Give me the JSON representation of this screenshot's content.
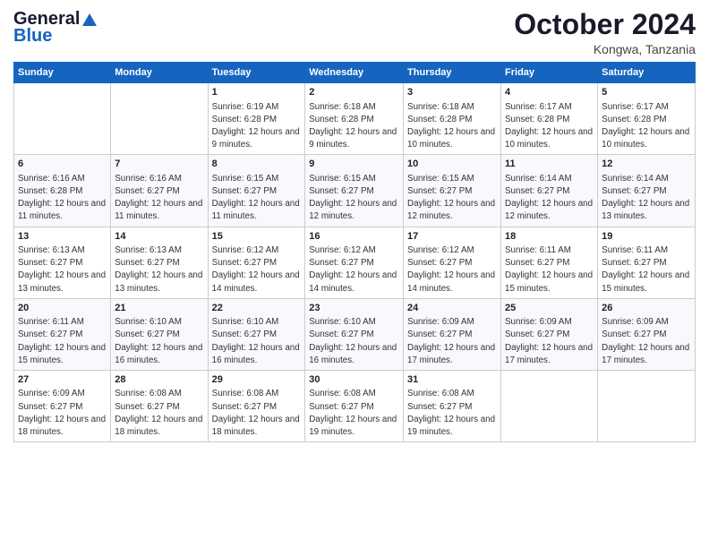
{
  "header": {
    "logo_line1": "General",
    "logo_line2": "Blue",
    "month_title": "October 2024",
    "location": "Kongwa, Tanzania"
  },
  "weekdays": [
    "Sunday",
    "Monday",
    "Tuesday",
    "Wednesday",
    "Thursday",
    "Friday",
    "Saturday"
  ],
  "weeks": [
    [
      {
        "day": "",
        "sunrise": "",
        "sunset": "",
        "daylight": ""
      },
      {
        "day": "",
        "sunrise": "",
        "sunset": "",
        "daylight": ""
      },
      {
        "day": "1",
        "sunrise": "Sunrise: 6:19 AM",
        "sunset": "Sunset: 6:28 PM",
        "daylight": "Daylight: 12 hours and 9 minutes."
      },
      {
        "day": "2",
        "sunrise": "Sunrise: 6:18 AM",
        "sunset": "Sunset: 6:28 PM",
        "daylight": "Daylight: 12 hours and 9 minutes."
      },
      {
        "day": "3",
        "sunrise": "Sunrise: 6:18 AM",
        "sunset": "Sunset: 6:28 PM",
        "daylight": "Daylight: 12 hours and 10 minutes."
      },
      {
        "day": "4",
        "sunrise": "Sunrise: 6:17 AM",
        "sunset": "Sunset: 6:28 PM",
        "daylight": "Daylight: 12 hours and 10 minutes."
      },
      {
        "day": "5",
        "sunrise": "Sunrise: 6:17 AM",
        "sunset": "Sunset: 6:28 PM",
        "daylight": "Daylight: 12 hours and 10 minutes."
      }
    ],
    [
      {
        "day": "6",
        "sunrise": "Sunrise: 6:16 AM",
        "sunset": "Sunset: 6:28 PM",
        "daylight": "Daylight: 12 hours and 11 minutes."
      },
      {
        "day": "7",
        "sunrise": "Sunrise: 6:16 AM",
        "sunset": "Sunset: 6:27 PM",
        "daylight": "Daylight: 12 hours and 11 minutes."
      },
      {
        "day": "8",
        "sunrise": "Sunrise: 6:15 AM",
        "sunset": "Sunset: 6:27 PM",
        "daylight": "Daylight: 12 hours and 11 minutes."
      },
      {
        "day": "9",
        "sunrise": "Sunrise: 6:15 AM",
        "sunset": "Sunset: 6:27 PM",
        "daylight": "Daylight: 12 hours and 12 minutes."
      },
      {
        "day": "10",
        "sunrise": "Sunrise: 6:15 AM",
        "sunset": "Sunset: 6:27 PM",
        "daylight": "Daylight: 12 hours and 12 minutes."
      },
      {
        "day": "11",
        "sunrise": "Sunrise: 6:14 AM",
        "sunset": "Sunset: 6:27 PM",
        "daylight": "Daylight: 12 hours and 12 minutes."
      },
      {
        "day": "12",
        "sunrise": "Sunrise: 6:14 AM",
        "sunset": "Sunset: 6:27 PM",
        "daylight": "Daylight: 12 hours and 13 minutes."
      }
    ],
    [
      {
        "day": "13",
        "sunrise": "Sunrise: 6:13 AM",
        "sunset": "Sunset: 6:27 PM",
        "daylight": "Daylight: 12 hours and 13 minutes."
      },
      {
        "day": "14",
        "sunrise": "Sunrise: 6:13 AM",
        "sunset": "Sunset: 6:27 PM",
        "daylight": "Daylight: 12 hours and 13 minutes."
      },
      {
        "day": "15",
        "sunrise": "Sunrise: 6:12 AM",
        "sunset": "Sunset: 6:27 PM",
        "daylight": "Daylight: 12 hours and 14 minutes."
      },
      {
        "day": "16",
        "sunrise": "Sunrise: 6:12 AM",
        "sunset": "Sunset: 6:27 PM",
        "daylight": "Daylight: 12 hours and 14 minutes."
      },
      {
        "day": "17",
        "sunrise": "Sunrise: 6:12 AM",
        "sunset": "Sunset: 6:27 PM",
        "daylight": "Daylight: 12 hours and 14 minutes."
      },
      {
        "day": "18",
        "sunrise": "Sunrise: 6:11 AM",
        "sunset": "Sunset: 6:27 PM",
        "daylight": "Daylight: 12 hours and 15 minutes."
      },
      {
        "day": "19",
        "sunrise": "Sunrise: 6:11 AM",
        "sunset": "Sunset: 6:27 PM",
        "daylight": "Daylight: 12 hours and 15 minutes."
      }
    ],
    [
      {
        "day": "20",
        "sunrise": "Sunrise: 6:11 AM",
        "sunset": "Sunset: 6:27 PM",
        "daylight": "Daylight: 12 hours and 15 minutes."
      },
      {
        "day": "21",
        "sunrise": "Sunrise: 6:10 AM",
        "sunset": "Sunset: 6:27 PM",
        "daylight": "Daylight: 12 hours and 16 minutes."
      },
      {
        "day": "22",
        "sunrise": "Sunrise: 6:10 AM",
        "sunset": "Sunset: 6:27 PM",
        "daylight": "Daylight: 12 hours and 16 minutes."
      },
      {
        "day": "23",
        "sunrise": "Sunrise: 6:10 AM",
        "sunset": "Sunset: 6:27 PM",
        "daylight": "Daylight: 12 hours and 16 minutes."
      },
      {
        "day": "24",
        "sunrise": "Sunrise: 6:09 AM",
        "sunset": "Sunset: 6:27 PM",
        "daylight": "Daylight: 12 hours and 17 minutes."
      },
      {
        "day": "25",
        "sunrise": "Sunrise: 6:09 AM",
        "sunset": "Sunset: 6:27 PM",
        "daylight": "Daylight: 12 hours and 17 minutes."
      },
      {
        "day": "26",
        "sunrise": "Sunrise: 6:09 AM",
        "sunset": "Sunset: 6:27 PM",
        "daylight": "Daylight: 12 hours and 17 minutes."
      }
    ],
    [
      {
        "day": "27",
        "sunrise": "Sunrise: 6:09 AM",
        "sunset": "Sunset: 6:27 PM",
        "daylight": "Daylight: 12 hours and 18 minutes."
      },
      {
        "day": "28",
        "sunrise": "Sunrise: 6:08 AM",
        "sunset": "Sunset: 6:27 PM",
        "daylight": "Daylight: 12 hours and 18 minutes."
      },
      {
        "day": "29",
        "sunrise": "Sunrise: 6:08 AM",
        "sunset": "Sunset: 6:27 PM",
        "daylight": "Daylight: 12 hours and 18 minutes."
      },
      {
        "day": "30",
        "sunrise": "Sunrise: 6:08 AM",
        "sunset": "Sunset: 6:27 PM",
        "daylight": "Daylight: 12 hours and 19 minutes."
      },
      {
        "day": "31",
        "sunrise": "Sunrise: 6:08 AM",
        "sunset": "Sunset: 6:27 PM",
        "daylight": "Daylight: 12 hours and 19 minutes."
      },
      {
        "day": "",
        "sunrise": "",
        "sunset": "",
        "daylight": ""
      },
      {
        "day": "",
        "sunrise": "",
        "sunset": "",
        "daylight": ""
      }
    ]
  ]
}
